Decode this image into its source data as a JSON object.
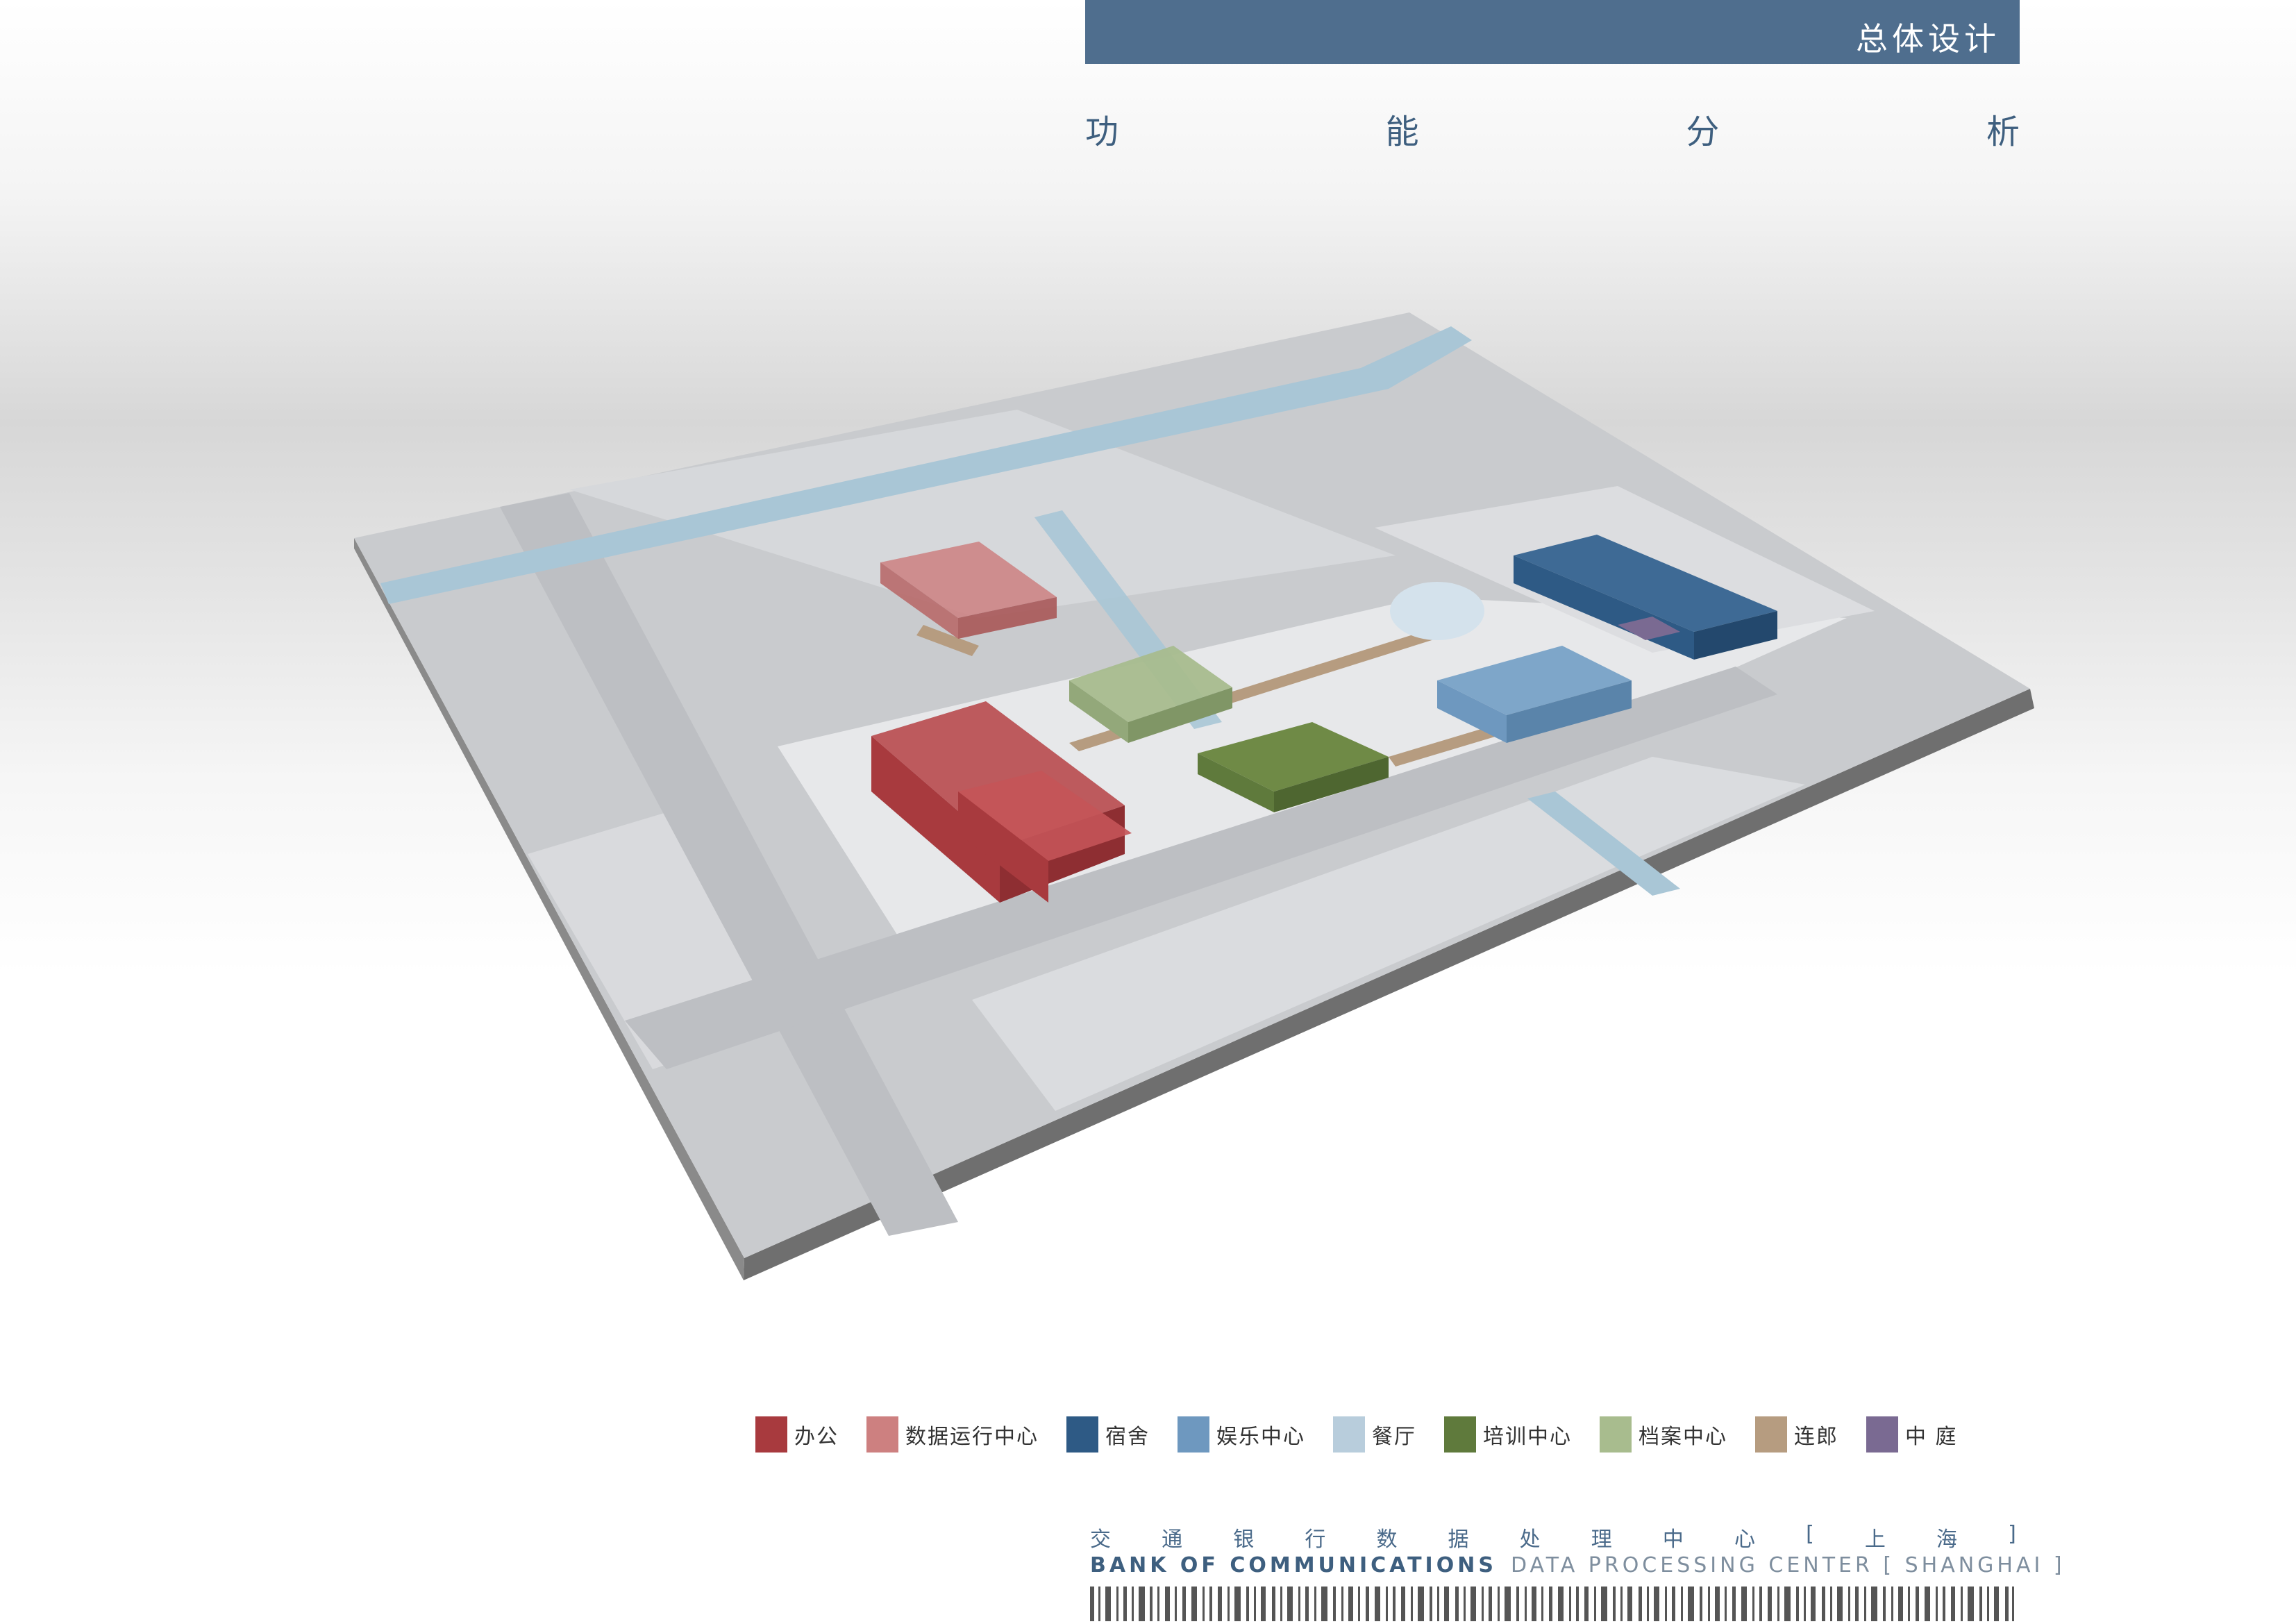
{
  "header": {
    "title": "总体设计"
  },
  "subtitle": {
    "chars": [
      "功",
      "能",
      "分",
      "析"
    ]
  },
  "legend": {
    "items": [
      {
        "label": "办公",
        "color": "#a83a3e"
      },
      {
        "label": "数据运行中心",
        "color": "#cd8080"
      },
      {
        "label": "宿舍",
        "color": "#2e5a85"
      },
      {
        "label": "娱乐中心",
        "color": "#6e98bf"
      },
      {
        "label": "餐厅",
        "color": "#b8cddc"
      },
      {
        "label": "培训中心",
        "color": "#5f7a3c"
      },
      {
        "label": "档案中心",
        "color": "#a8bc8e"
      },
      {
        "label": "连郎",
        "color": "#b69c80"
      },
      {
        "label": "中 庭",
        "color": "#7a6a92"
      }
    ]
  },
  "footer": {
    "cn_chars": [
      "交",
      "通",
      "银",
      "行",
      "数",
      "据",
      "处",
      "理",
      "中",
      "心",
      "[",
      "上",
      "海",
      "]"
    ],
    "en_bank": "BANK OF COMMUNICATIONS",
    "en_rest": "DATA PROCESSING CENTER [ SHANGHAI ]"
  }
}
